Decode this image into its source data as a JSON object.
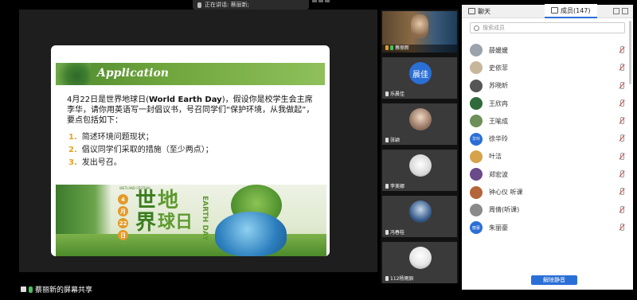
{
  "top_bar": {
    "speaking_text": "正在讲话: 蔡丽新;"
  },
  "slide": {
    "title": "Application",
    "intro_part1": "4月22日是世界地球日(",
    "intro_bold": "World Earth Day",
    "intro_part2": ")，假设你是校学生会主席李华，请你用英语写一封倡议书，号召同学们“保护环境，从我做起”，要点包括如下：",
    "bullets": [
      {
        "num": "1.",
        "text": "简述环境问题现状；"
      },
      {
        "num": "2.",
        "text": "倡议同学们采取的措施（至少两点）；"
      },
      {
        "num": "3.",
        "text": "发出号召。"
      }
    ],
    "banner": {
      "label": "WETLAND FESTIVAL",
      "date": [
        "4",
        "月",
        "22",
        "日"
      ],
      "title_chars": [
        "世",
        "界",
        "地",
        "球",
        "日"
      ],
      "title_line1_left": "世",
      "title_line2_left": "界",
      "title_line1_right": "地",
      "title_line2_right": "球日",
      "english": "EARTH DAY"
    }
  },
  "presenter": {
    "label": "蔡丽新的屏幕共享"
  },
  "videos": [
    {
      "name": "蔡丽新",
      "avatar": "camera"
    },
    {
      "name": "乐晨佳",
      "avatar_text": "晨佳"
    },
    {
      "name": "张颖",
      "avatar": "photo"
    },
    {
      "name": "李美娜",
      "avatar": "cat"
    },
    {
      "name": "冯春桂",
      "avatar": "night-sky"
    },
    {
      "name": "112杨雨辰",
      "avatar": "anime"
    }
  ],
  "panel": {
    "tab_chat": "聊天",
    "tab_members": "成员(147)",
    "search_placeholder": "搜索成员",
    "members": [
      {
        "name": "薛媛媛",
        "avatar_color": "#9aa3ad"
      },
      {
        "name": "史依菲",
        "avatar_color": "#c7b69a"
      },
      {
        "name": "苏晓昕",
        "avatar_color": "#555555"
      },
      {
        "name": "王欣冉",
        "avatar_color": "#2f6a3a"
      },
      {
        "name": "王喻成",
        "avatar_color": "#6f8f5a"
      },
      {
        "name": "徐华玲",
        "avatar_color": "#2a6fd6",
        "avatar_text": "华玲"
      },
      {
        "name": "叶洁",
        "avatar_color": "#d6a24a"
      },
      {
        "name": "郑宏波",
        "avatar_color": "#6a4a8a"
      },
      {
        "name": "钟心仪 听课",
        "avatar_color": "#b5653a"
      },
      {
        "name": "周倩(听课)",
        "avatar_color": "#8a8a8a"
      },
      {
        "name": "朱丽豪",
        "avatar_color": "#2a6fd6",
        "avatar_text": "丽豪"
      }
    ],
    "unmute_all_label": "解除静音"
  }
}
